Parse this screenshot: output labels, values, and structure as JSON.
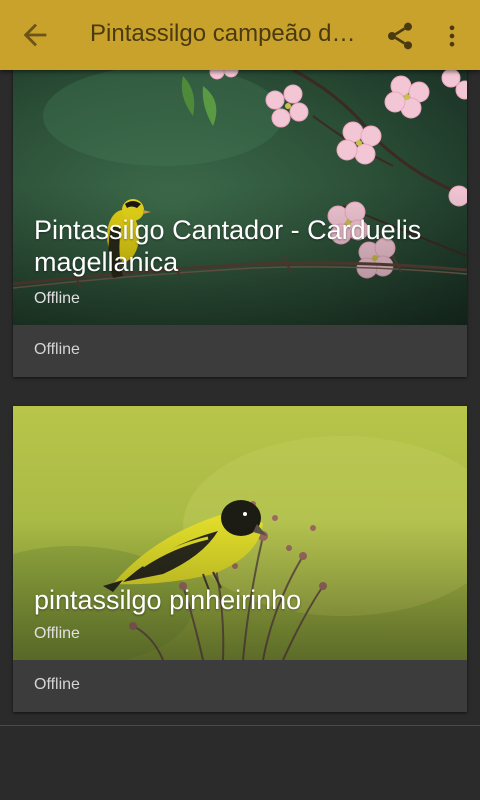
{
  "appbar": {
    "title": "Pintassilgo campeão de canto",
    "back_icon": "arrow-back-icon",
    "share_icon": "share-icon",
    "more_icon": "more-vert-icon",
    "color": "#c9a22c"
  },
  "cards": [
    {
      "title": "Pintassilgo Cantador - Carduelis magellanica",
      "overlay_status": "Offline",
      "footer_status": "Offline",
      "image": "goldfinch-on-barbed-wire-with-dogwood-blossoms"
    },
    {
      "title": "pintassilgo pinheirinho",
      "overlay_status": "Offline",
      "footer_status": "Offline",
      "image": "siskin-on-wildflower-stems"
    }
  ]
}
